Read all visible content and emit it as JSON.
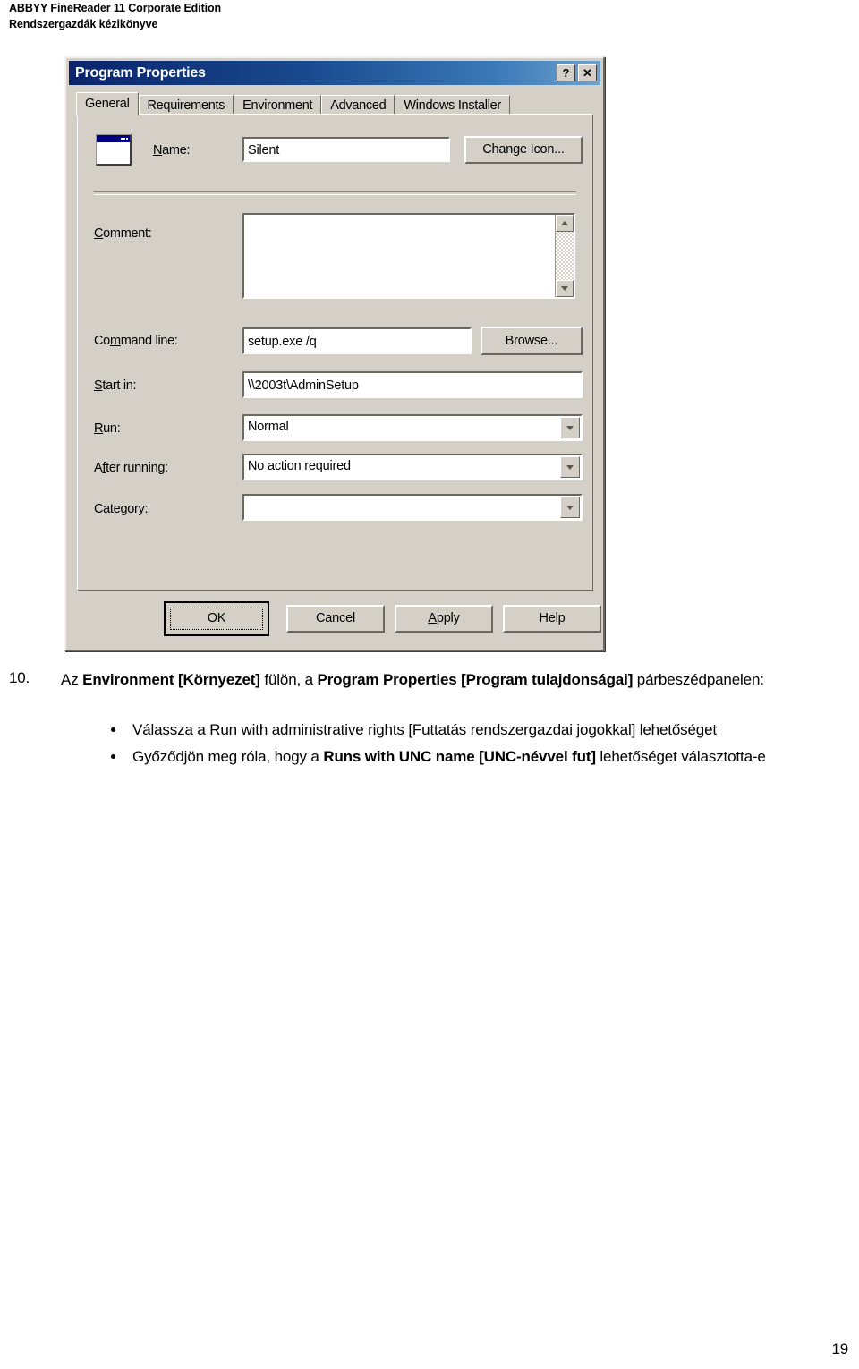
{
  "header": {
    "line1": "ABBYY FineReader 11 Corporate Edition",
    "line2": "Rendszergazdák kézikönyve"
  },
  "dialog": {
    "title": "Program Properties",
    "titlebar_buttons": [
      {
        "name": "help-button",
        "glyph": "?"
      },
      {
        "name": "close-button",
        "glyph": "✕"
      }
    ],
    "tabs": [
      {
        "label": "General",
        "active": true
      },
      {
        "label": "Requirements",
        "active": false
      },
      {
        "label": "Environment",
        "active": false
      },
      {
        "label": "Advanced",
        "active": false
      },
      {
        "label": "Windows Installer",
        "active": false
      }
    ],
    "fields": {
      "name_label": "Name:",
      "name_value": "Silent",
      "change_icon_label": "Change Icon...",
      "comment_label": "Comment:",
      "comment_value": "",
      "command_line_label": "Command line:",
      "command_line_value": "setup.exe /q",
      "browse_label": "Browse...",
      "start_in_label": "Start in:",
      "start_in_value": "\\\\2003t\\AdminSetup",
      "run_label": "Run:",
      "run_value": "Normal",
      "after_running_label": "After running:",
      "after_running_value": "No action required",
      "category_label": "Category:",
      "category_value": ""
    },
    "buttons": {
      "ok": "OK",
      "cancel": "Cancel",
      "apply": "Apply",
      "help": "Help"
    }
  },
  "content": {
    "step_number": "10.",
    "step_text_parts": [
      {
        "text": "Az ",
        "bold": false
      },
      {
        "text": "Environment [Környezet]",
        "bold": true
      },
      {
        "text": " fülön, a ",
        "bold": false
      },
      {
        "text": "Program Properties [Program tulajdonságai]",
        "bold": true
      },
      {
        "text": " párbeszédpanelen:",
        "bold": false
      }
    ],
    "bullets": [
      [
        {
          "text": "Válassza a ",
          "bold": false
        },
        {
          "text": "Run with administrative rights [Futtatás rendszergazdai jogokkal]",
          "bold": false
        },
        {
          "text": " lehetőséget",
          "bold": false
        }
      ],
      [
        {
          "text": "Győződjön meg róla, hogy a ",
          "bold": false
        },
        {
          "text": "Runs with UNC name [UNC-névvel fut]",
          "bold": true
        },
        {
          "text": " lehetőséget választotta-e",
          "bold": false
        }
      ]
    ],
    "page_number": "19"
  },
  "colors": {
    "dialog_face": "#d4d0c8",
    "titlebar_start": "#0a246a",
    "titlebar_end": "#6ea2cf",
    "icon_titlebar": "#000080"
  }
}
